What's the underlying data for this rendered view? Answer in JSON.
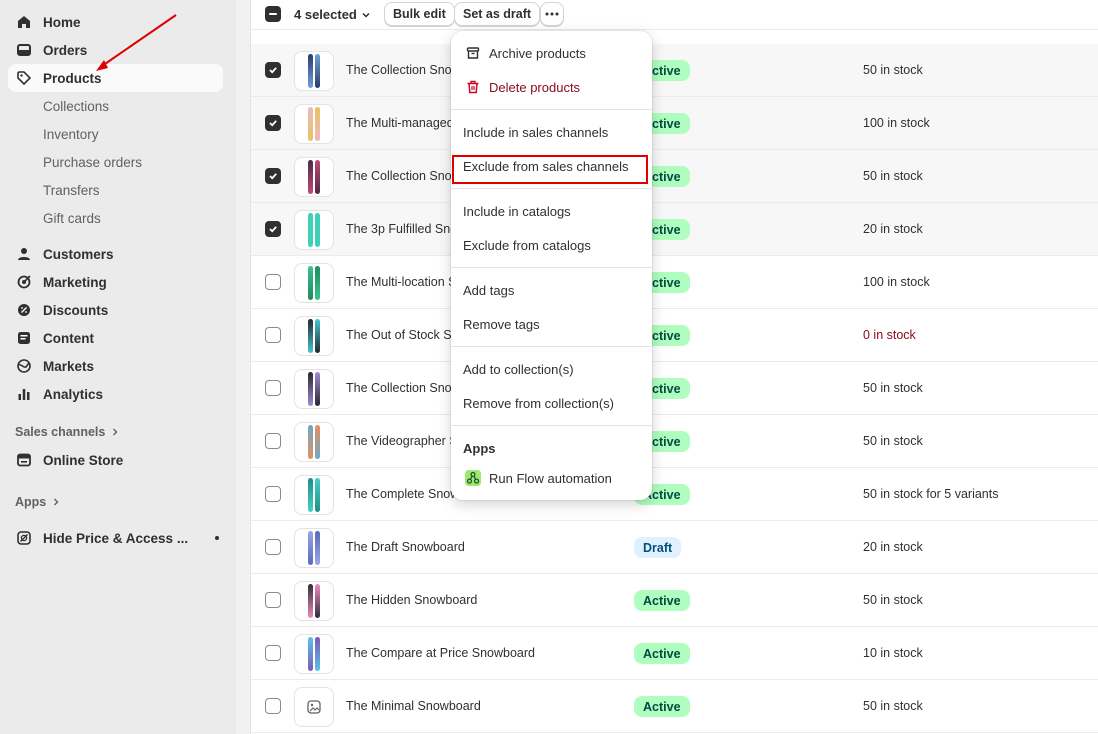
{
  "sidebar": {
    "items": [
      {
        "label": "Home",
        "icon": "home-icon"
      },
      {
        "label": "Orders",
        "icon": "orders-icon"
      },
      {
        "label": "Products",
        "icon": "tag-icon"
      },
      {
        "label": "Collections"
      },
      {
        "label": "Inventory"
      },
      {
        "label": "Purchase orders"
      },
      {
        "label": "Transfers"
      },
      {
        "label": "Gift cards"
      },
      {
        "label": "Customers",
        "icon": "person-icon"
      },
      {
        "label": "Marketing",
        "icon": "target-icon"
      },
      {
        "label": "Discounts",
        "icon": "discount-icon"
      },
      {
        "label": "Content",
        "icon": "content-icon"
      },
      {
        "label": "Markets",
        "icon": "globe-icon"
      },
      {
        "label": "Analytics",
        "icon": "bar-chart-icon"
      }
    ],
    "sales_channels_label": "Sales channels",
    "online_store": "Online Store",
    "apps_label": "Apps",
    "app_item": "Hide Price & Access ..."
  },
  "toolbar": {
    "selected": "4 selected",
    "bulk_edit": "Bulk edit",
    "set_as_draft": "Set as draft"
  },
  "menu": {
    "archive": "Archive products",
    "delete": "Delete products",
    "include_sales": "Include in sales channels",
    "exclude_sales": "Exclude from sales channels",
    "include_catalogs": "Include in catalogs",
    "exclude_catalogs": "Exclude from catalogs",
    "add_tags": "Add tags",
    "remove_tags": "Remove tags",
    "add_collection": "Add to collection(s)",
    "remove_collection": "Remove from collection(s)",
    "apps_heading": "Apps",
    "run_flow": "Run Flow automation"
  },
  "products": [
    {
      "name": "The Collection Snowboard: Liquid",
      "status": "Active",
      "stock": "50 in stock",
      "selected": true
    },
    {
      "name": "The Multi-managed Snowboard",
      "status": "Active",
      "stock": "100 in stock",
      "selected": true
    },
    {
      "name": "The Collection Snowboard: Oxygen",
      "status": "Active",
      "stock": "50 in stock",
      "selected": true
    },
    {
      "name": "The 3p Fulfilled Snowboard",
      "status": "Active",
      "stock": "20 in stock",
      "selected": true
    },
    {
      "name": "The Multi-location Snowboard",
      "status": "Active",
      "stock": "100 in stock",
      "selected": false
    },
    {
      "name": "The Out of Stock Snowboard",
      "status": "Active",
      "stock": "0 in stock",
      "selected": false
    },
    {
      "name": "The Collection Snowboard: Hydrogen",
      "status": "Active",
      "stock": "50 in stock",
      "selected": false
    },
    {
      "name": "The Videographer Snowboard",
      "status": "Active",
      "stock": "50 in stock",
      "selected": false
    },
    {
      "name": "The Complete Snowboard",
      "status": "Active",
      "stock": "50 in stock for 5 variants",
      "selected": false
    },
    {
      "name": "The Draft Snowboard",
      "status": "Draft",
      "stock": "20 in stock",
      "selected": false
    },
    {
      "name": "The Hidden Snowboard",
      "status": "Active",
      "stock": "50 in stock",
      "selected": false
    },
    {
      "name": "The Compare at Price Snowboard",
      "status": "Active",
      "stock": "10 in stock",
      "selected": false
    },
    {
      "name": "The Minimal Snowboard",
      "status": "Active",
      "stock": "50 in stock",
      "selected": false
    }
  ],
  "colors": {
    "active_badge": "#affebf",
    "draft_badge": "#e0f0ff",
    "danger": "#8e0b21",
    "highlight_box": "#e00000"
  }
}
